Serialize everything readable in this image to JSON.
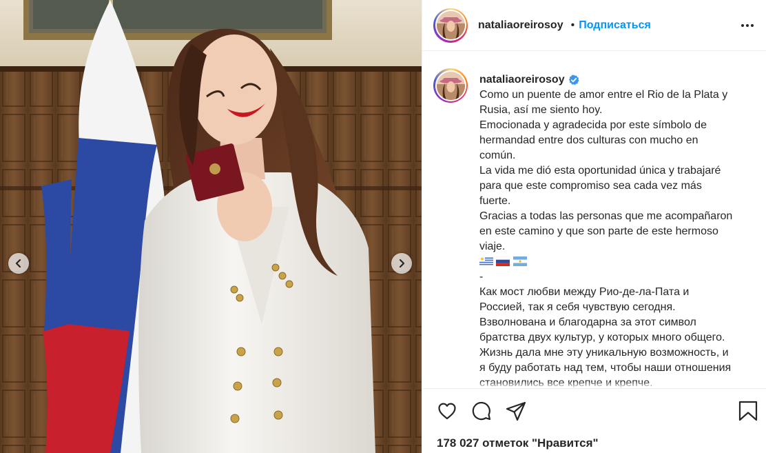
{
  "header": {
    "username": "nataliaoreirosoy",
    "separator": "•",
    "follow_label": "Подписаться"
  },
  "caption": {
    "username": "nataliaoreirosoy",
    "lines": [
      "Como un puente de amor entre el Rio de la Plata y",
      "Rusia, así me siento hoy.",
      "Emocionada y agradecida por este símbolo de",
      "hermandad entre dos culturas con mucho en",
      "común.",
      "La vida me dió esta oportunidad única y trabajaré",
      "para que este compromiso sea cada vez más",
      "fuerte.",
      "Gracias a todas las personas que me acompañaron",
      "en este camino y que son parte de este hermoso",
      "viaje.",
      "",
      "-",
      "Как мост любви между Рио-де-ла-Пата и",
      "Россией, так я себя чувствую сегодня.",
      "Взволнована и благодарна за этот символ",
      "братства двух культур, у которых много общего.",
      "Жизнь дала мне эту уникальную возможность, и",
      "я буду работать над тем, чтобы наши отношения",
      "становились все крепче и крепче."
    ],
    "flags": [
      "uruguay-flag",
      "russia-flag",
      "argentina-flag"
    ]
  },
  "actions": {
    "likes_text": "178 027 отметок \"Нравится\"",
    "icons": [
      "heart-icon",
      "comment-icon",
      "share-icon",
      "bookmark-icon"
    ]
  },
  "media": {
    "icons": [
      "chevron-left-icon",
      "chevron-right-icon"
    ]
  },
  "colors": {
    "accent": "#0095f6",
    "text": "#262626",
    "verified": "#3897f0",
    "divider": "#efefef"
  }
}
